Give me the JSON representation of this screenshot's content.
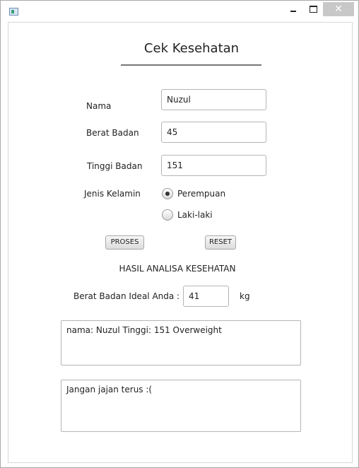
{
  "window": {
    "icon": "app-window-icon",
    "controls": {
      "minimize": "minimize-icon",
      "maximize": "maximize-icon",
      "close_symbol": "✕"
    }
  },
  "form": {
    "title": "Cek Kesehatan",
    "nama_label": "Nama",
    "nama_value": "Nuzul",
    "berat_label": "Berat Badan",
    "berat_value": "45",
    "tinggi_label": "Tinggi Badan",
    "tinggi_value": "151",
    "gender_label": "Jenis Kelamin",
    "gender_options": [
      {
        "label": "Perempuan",
        "selected": true
      },
      {
        "label": "Laki-laki",
        "selected": false
      }
    ],
    "proses_button": "PROSES",
    "reset_button": "RESET"
  },
  "result": {
    "heading": "HASIL ANALISA KESEHATAN",
    "ideal_label": "Berat Badan Ideal Anda :",
    "ideal_value": "41",
    "ideal_unit": "kg",
    "summary_text": "nama: Nuzul Tinggi: 151 Overweight",
    "advice_text": "Jangan jajan terus :("
  }
}
